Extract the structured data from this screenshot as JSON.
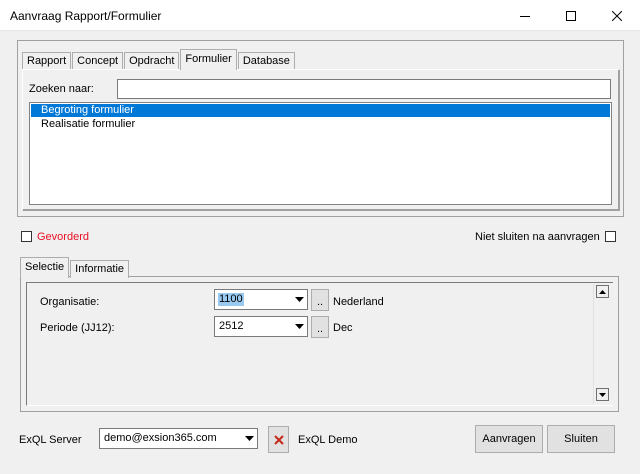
{
  "window": {
    "title": "Aanvraag Rapport/Formulier"
  },
  "main_tabs": [
    {
      "label": "Rapport"
    },
    {
      "label": "Concept"
    },
    {
      "label": "Opdracht"
    },
    {
      "label": "Formulier"
    },
    {
      "label": "Database"
    }
  ],
  "search": {
    "label": "Zoeken naar:",
    "value": ""
  },
  "list": {
    "items": [
      {
        "label": "Begroting formulier"
      },
      {
        "label": "Realisatie formulier"
      }
    ]
  },
  "options": {
    "gevorderd_label": "Gevorderd",
    "gevorderd_color": "#e81123",
    "niet_sluiten_label": "Niet sluiten na aanvragen"
  },
  "sub_tabs": [
    {
      "label": "Selectie"
    },
    {
      "label": "Informatie"
    }
  ],
  "fields": {
    "organisatie": {
      "label": "Organisatie:",
      "value": "1100",
      "desc": "Nederland",
      "button": ".."
    },
    "periode": {
      "label": "Periode (JJ12):",
      "value": "2512",
      "desc": "Dec",
      "button": ".."
    }
  },
  "footer": {
    "server_label": "ExQL Server",
    "server_value": "demo@exsion365.com",
    "server_name": "ExQL Demo",
    "aanvragen": "Aanvragen",
    "sluiten": "Sluiten"
  },
  "icons": {
    "minimize": "minimize-icon",
    "maximize": "maximize-icon",
    "close": "close-icon",
    "delete": "delete-x-icon"
  },
  "colors": {
    "selection": "#0078d7",
    "delete_x": "#c42b1c"
  }
}
